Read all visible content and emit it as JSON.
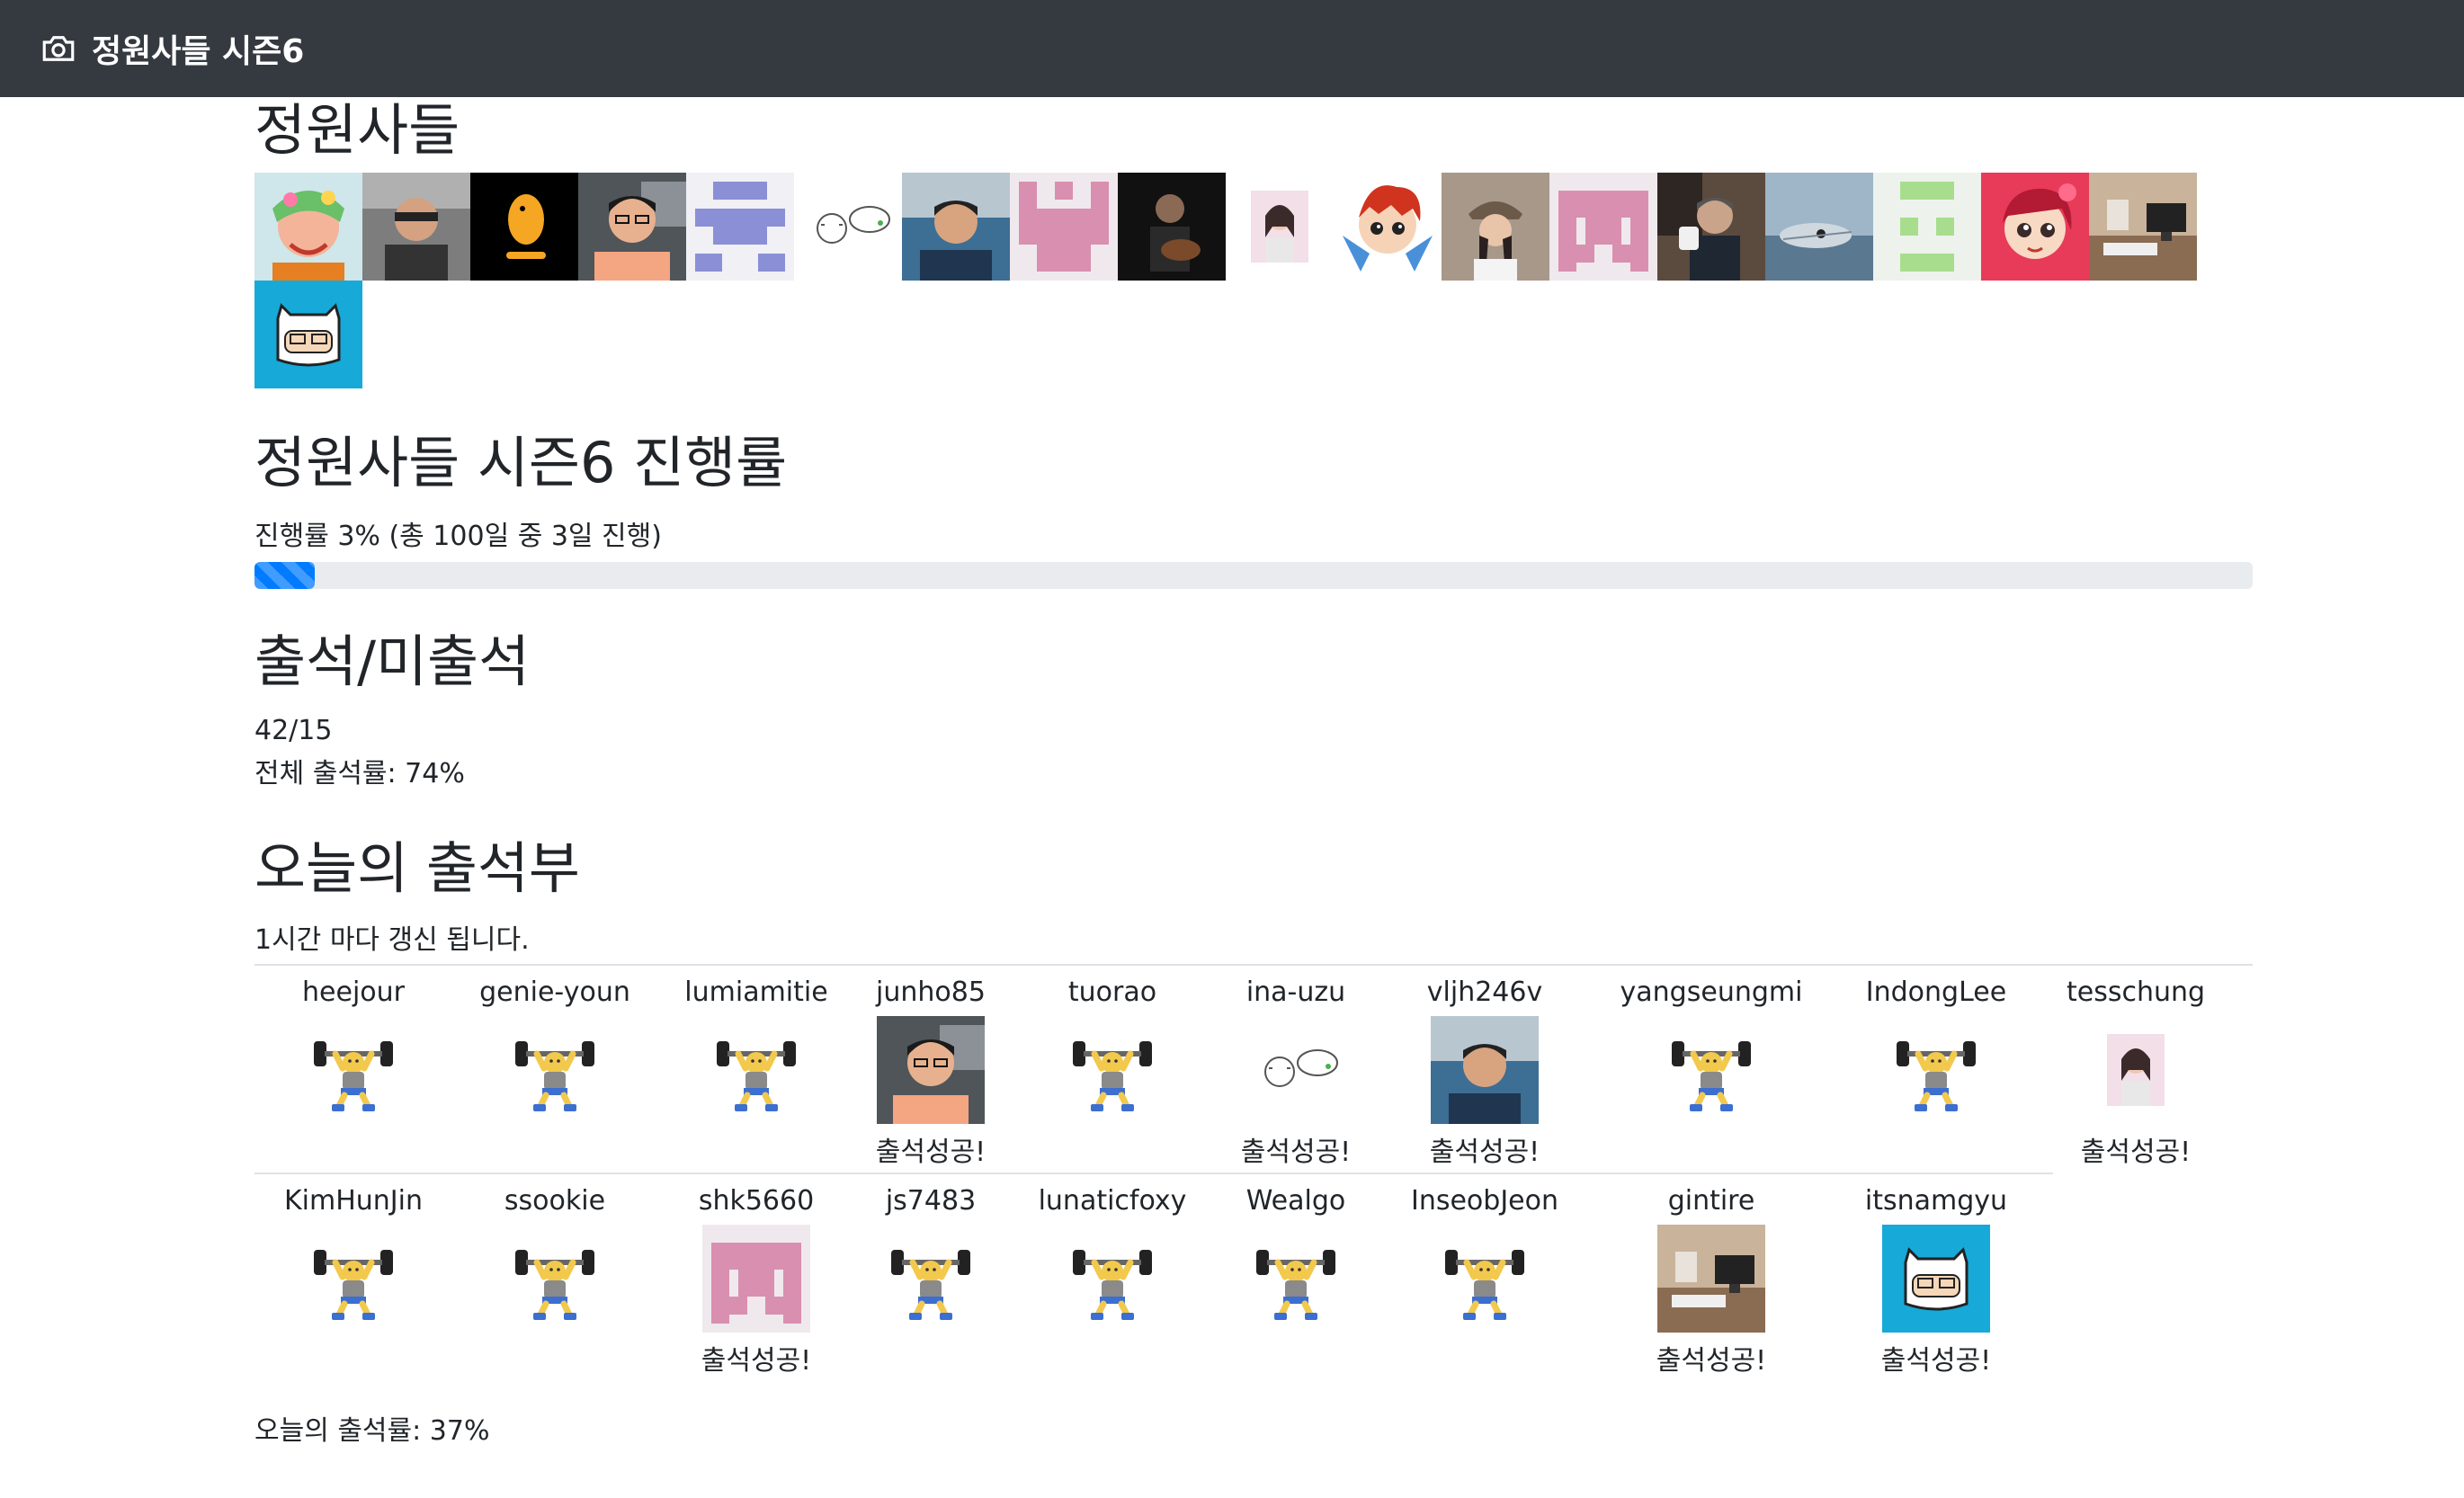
{
  "navbar": {
    "brand_title": "정원사들 시즌6",
    "brand_icon": "camera-icon"
  },
  "members": {
    "title": "정원사들",
    "avatars": [
      "avatar-heejour",
      "avatar-genie-youn",
      "avatar-lumiamitie",
      "avatar-junho85",
      "avatar-tuorao",
      "avatar-ina-uzu",
      "avatar-vljh246v",
      "avatar-yangseungmi",
      "avatar-IndongLee",
      "avatar-tesschung",
      "avatar-KimHunJin",
      "avatar-ssookie",
      "avatar-shk5660",
      "avatar-js7483",
      "avatar-lunaticfoxy",
      "avatar-Wealgo",
      "avatar-InseobJeon",
      "avatar-gintire",
      "avatar-itsnamgyu"
    ]
  },
  "progress": {
    "title": "정원사들 시즌6 진행률",
    "text": "진행률 3% (총 100일 중 3일 진행)",
    "percent": 3,
    "bar_color": "#007bff"
  },
  "attendance": {
    "title": "출석/미출석",
    "ratio": "42/15",
    "overall_rate": "전체 출석률: 74%"
  },
  "today": {
    "title": "오늘의 출석부",
    "refresh_note": "1시간 마다 갱신 됩니다.",
    "success_label": "출석성공!",
    "row1": [
      {
        "user": "heejour",
        "status": "missing",
        "status_label": ""
      },
      {
        "user": "genie-youn",
        "status": "missing",
        "status_label": ""
      },
      {
        "user": "lumiamitie",
        "status": "missing",
        "status_label": ""
      },
      {
        "user": "junho85",
        "status": "success",
        "status_label": "출석성공!"
      },
      {
        "user": "tuorao",
        "status": "missing",
        "status_label": ""
      },
      {
        "user": "ina-uzu",
        "status": "success",
        "status_label": "출석성공!"
      },
      {
        "user": "vljh246v",
        "status": "success",
        "status_label": "출석성공!"
      },
      {
        "user": "yangseungmi",
        "status": "missing",
        "status_label": ""
      },
      {
        "user": "IndongLee",
        "status": "missing",
        "status_label": ""
      },
      {
        "user": "tesschung",
        "status": "success",
        "status_label": "출석성공!"
      }
    ],
    "row2": [
      {
        "user": "KimHunJin",
        "status": "missing",
        "status_label": ""
      },
      {
        "user": "ssookie",
        "status": "missing",
        "status_label": ""
      },
      {
        "user": "shk5660",
        "status": "success",
        "status_label": "출석성공!"
      },
      {
        "user": "js7483",
        "status": "missing",
        "status_label": ""
      },
      {
        "user": "lunaticfoxy",
        "status": "missing",
        "status_label": ""
      },
      {
        "user": "Wealgo",
        "status": "missing",
        "status_label": ""
      },
      {
        "user": "InseobJeon",
        "status": "missing",
        "status_label": ""
      },
      {
        "user": "gintire",
        "status": "success",
        "status_label": "출석성공!"
      },
      {
        "user": "itsnamgyu",
        "status": "success",
        "status_label": "출석성공!"
      }
    ],
    "rate": "오늘의 출석률: 37%",
    "missing_icon": "weightlifter-icon"
  }
}
